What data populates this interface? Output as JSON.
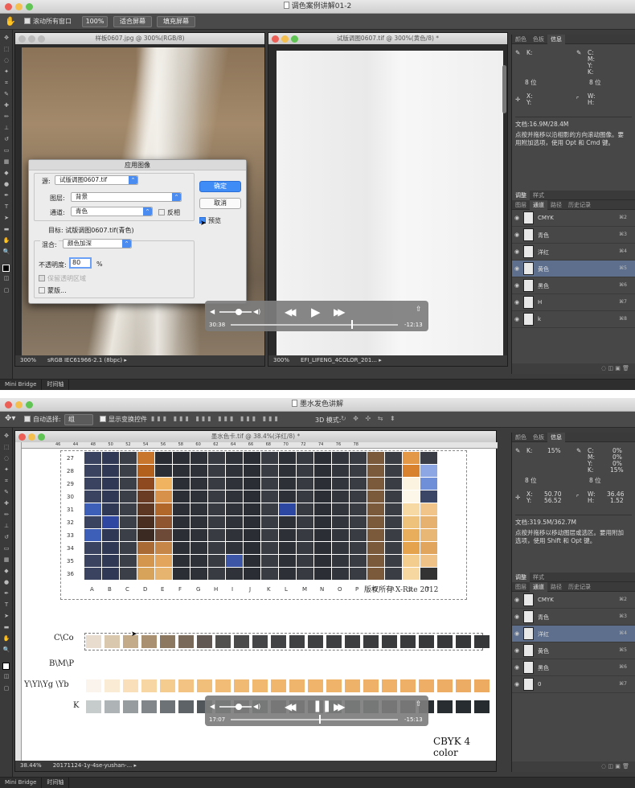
{
  "shot1": {
    "app_title": "调色案例讲解01-2",
    "options": {
      "scroll_all_label": "滚动所有窗口",
      "zoom_btn": "100%",
      "fit_btn": "适合屏幕",
      "fill_btn": "填充屏幕"
    },
    "doc1": {
      "title": "样板0607.jpg @ 300%(RGB/8)",
      "zoom": "300%",
      "profile": "sRGB IEC61966-2.1 (8bpc)"
    },
    "doc2": {
      "title": "试版调图0607.tif @ 300%(黄色/8) *",
      "zoom": "300%",
      "file": "EFI_LIFENG_4COLOR_201..."
    },
    "dialog": {
      "title": "应用图像",
      "source_label": "源:",
      "source_value": "试版调图0607.tif",
      "layer_label": "图层:",
      "layer_value": "背景",
      "channel_label": "通道:",
      "channel_value": "青色",
      "invert_label": "反相",
      "target_label": "目标:",
      "target_value": "试版调图0607.tif(青色)",
      "blend_label": "混合:",
      "blend_value": "颜色加深",
      "opacity_label": "不透明度:",
      "opacity_value": "80",
      "opacity_unit": "%",
      "preserve_label": "保留透明区域",
      "mask_label": "蒙版...",
      "ok": "确定",
      "cancel": "取消",
      "preview": "预览"
    },
    "panel": {
      "tabs": [
        "颜色",
        "色板",
        "信息"
      ],
      "k_label": "K:",
      "c_label": "C:",
      "m_label": "M:",
      "y_label": "Y:",
      "k2_label": "K:",
      "bits1": "8 位",
      "bits2": "8 位",
      "x_label": "X:",
      "y2_label": "Y:",
      "w_label": "W:",
      "h_label": "H:",
      "doc_size": "文档:16.9M/28.4M",
      "hint": "点按并拖移以沿相影的方向滚动图像。要用附加选项，使用 Opt 和 Cmd 键。",
      "adj_tabs": [
        "调整",
        "样式"
      ],
      "chan_tabs": [
        "图层",
        "通道",
        "路径",
        "历史记录"
      ],
      "channels": [
        {
          "name": "CMYK",
          "sc": "⌘2"
        },
        {
          "name": "青色",
          "sc": "⌘3"
        },
        {
          "name": "洋红",
          "sc": "⌘4"
        },
        {
          "name": "黄色",
          "sc": "⌘5"
        },
        {
          "name": "黑色",
          "sc": "⌘6"
        },
        {
          "name": "H",
          "sc": "⌘7"
        },
        {
          "name": "k",
          "sc": "⌘8"
        }
      ],
      "selected_channel": 3
    },
    "player": {
      "elapsed": "30:38",
      "remaining": "-12:13",
      "progress": 0.72,
      "volume": 0.55
    },
    "bridge": [
      "Mini Bridge",
      "时间轴"
    ]
  },
  "shot2": {
    "app_title": "墨水发色讲解",
    "options": {
      "auto_select_label": "自动选择:",
      "auto_select_value": "组",
      "show_transform_label": "显示变换控件",
      "mode_3d": "3D 模式:"
    },
    "doc": {
      "title": "墨水色卡.tif @ 38.4%(洋红/8) *",
      "zoom": "38.44%",
      "file": "20171124-1y-4se-yushan-..."
    },
    "ruler_h": [
      "46",
      "44",
      "48",
      "50",
      "52",
      "54",
      "56",
      "58",
      "60",
      "62",
      "64",
      "66",
      "68",
      "70",
      "72",
      "74",
      "76",
      "78"
    ],
    "row_numbers": [
      "27",
      "28",
      "29",
      "30",
      "31",
      "32",
      "33",
      "34",
      "35",
      "36"
    ],
    "col_letters": [
      "A",
      "B",
      "C",
      "D",
      "E",
      "F",
      "G",
      "H",
      "I",
      "J",
      "K",
      "L",
      "M",
      "N",
      "O",
      "P",
      "Q",
      "R",
      "S",
      "T"
    ],
    "copyright": "版权所有  X-Rite 2012",
    "row_labels": {
      "c": "C\\Co",
      "b": "B\\M\\P",
      "y": "Y\\Yl\\Yg \\Yb",
      "k": "K"
    },
    "caption": "CBYK   4 color",
    "panel": {
      "tabs": [
        "颜色",
        "色板",
        "信息"
      ],
      "k_label": "K:",
      "k_value": "15%",
      "c_label": "C:",
      "c_value": "0%",
      "m_label": "M:",
      "m_value": "0%",
      "y_label": "Y:",
      "y_value": "0%",
      "k2_label": "K:",
      "k2_value": "15%",
      "bits1": "8 位",
      "bits2": "8 位",
      "x_label": "X:",
      "x_value": "50.70",
      "y2_label": "Y:",
      "y2_value": "56.52",
      "w_label": "W:",
      "w_value": "36.46",
      "h_label": "H:",
      "h_value": "1.52",
      "doc_size": "文档:319.5M/362.7M",
      "hint": "点按并拖移以移动图层或选区。要用附加选项，使用 Shift 和 Opt 键。",
      "adj_tabs": [
        "调整",
        "样式"
      ],
      "chan_tabs": [
        "图层",
        "通道",
        "路径",
        "历史记录"
      ],
      "channels": [
        {
          "name": "CMYK",
          "sc": "⌘2"
        },
        {
          "name": "青色",
          "sc": "⌘3"
        },
        {
          "name": "洋红",
          "sc": "⌘4"
        },
        {
          "name": "黄色",
          "sc": "⌘5"
        },
        {
          "name": "黑色",
          "sc": "⌘6"
        },
        {
          "name": "0",
          "sc": "⌘7"
        }
      ],
      "selected_channel": 2
    },
    "player": {
      "elapsed": "17:07",
      "remaining": "-15:13",
      "progress": 0.53,
      "volume": 0.55
    },
    "bridge": [
      "Mini Bridge",
      "时间轴"
    ]
  },
  "colors": {
    "accent": "#3f8cf6",
    "selected_row": "#5d6f8d",
    "panel_bg": "#474747"
  }
}
